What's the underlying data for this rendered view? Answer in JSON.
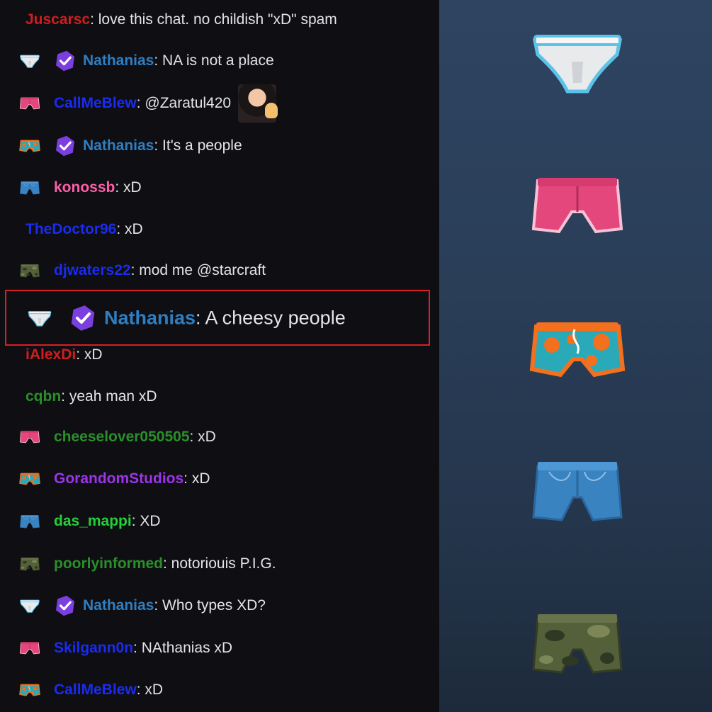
{
  "chat": {
    "messages": [
      {
        "id": "m1",
        "user": "Juscarsc",
        "color": "#d11d1d",
        "badge": null,
        "verified": false,
        "text": ": love this chat. no childish \"xD\" spam"
      },
      {
        "id": "m2",
        "user": "Nathanias",
        "color": "#2f7ec0",
        "badge": "white-briefs",
        "verified": true,
        "text": ": NA is not a place"
      },
      {
        "id": "m3",
        "user": "CallMeBlew",
        "color": "#1a2cf0",
        "badge": "pink-shorts",
        "verified": false,
        "text": ": @Zaratul420",
        "emote": "waving-woman-emote"
      },
      {
        "id": "m4",
        "user": "Nathanias",
        "color": "#2f7ec0",
        "badge": "orange-trunks",
        "verified": true,
        "text": ": It's a people"
      },
      {
        "id": "m5",
        "user": "konossb",
        "color": "#ff5fa8",
        "badge": "denim-shorts",
        "verified": false,
        "text": ": xD"
      },
      {
        "id": "m6",
        "user": "TheDoctor96",
        "color": "#1a2cf0",
        "badge": null,
        "verified": false,
        "text": ": xD"
      },
      {
        "id": "m7",
        "user": "djwaters22",
        "color": "#1a2cf0",
        "badge": "camo-shorts",
        "verified": false,
        "text": ": mod me @starcraft"
      },
      {
        "id": "m8",
        "user": "Nathanias",
        "color": "#2f7ec0",
        "badge": "white-briefs",
        "verified": true,
        "text": ": A cheesy people",
        "highlighted": true
      },
      {
        "id": "m9",
        "user": "iAlexDi",
        "color": "#d11d1d",
        "badge": null,
        "verified": false,
        "text": ": xD"
      },
      {
        "id": "m10",
        "user": "cqbn",
        "color": "#2a8f2a",
        "badge": null,
        "verified": false,
        "text": ": yeah man xD"
      },
      {
        "id": "m11",
        "user": "cheeselover050505",
        "color": "#2a8f2a",
        "badge": "pink-shorts",
        "verified": false,
        "text": ": xD"
      },
      {
        "id": "m12",
        "user": "GorandomStudios",
        "color": "#9b35e8",
        "badge": "orange-trunks",
        "verified": false,
        "text": ": xD"
      },
      {
        "id": "m13",
        "user": "das_mappi",
        "color": "#22d13a",
        "badge": "denim-shorts",
        "verified": false,
        "text": ": XD"
      },
      {
        "id": "m14",
        "user": "poorlyinformed",
        "color": "#2a8f2a",
        "badge": "camo-shorts",
        "verified": false,
        "text": ": notoriouis P.I.G."
      },
      {
        "id": "m15",
        "user": "Nathanias",
        "color": "#2f7ec0",
        "badge": "white-briefs",
        "verified": true,
        "text": ": Who types XD?"
      },
      {
        "id": "m16",
        "user": "Skilgann0n",
        "color": "#1a2cf0",
        "badge": "pink-shorts",
        "verified": false,
        "text": ": NAthanias xD"
      },
      {
        "id": "m17",
        "user": "CallMeBlew",
        "color": "#1a2cf0",
        "badge": "orange-trunks",
        "verified": false,
        "text": ": xD"
      }
    ]
  },
  "sidebar": {
    "items": [
      {
        "id": "g1",
        "icon": "white-briefs-icon"
      },
      {
        "id": "g2",
        "icon": "pink-shorts-icon"
      },
      {
        "id": "g3",
        "icon": "orange-trunks-icon"
      },
      {
        "id": "g4",
        "icon": "denim-shorts-icon"
      },
      {
        "id": "g5",
        "icon": "camo-shorts-icon"
      }
    ]
  },
  "colors": {
    "chat_bg": "#0f0e13",
    "highlight_border": "#d81f24",
    "verified_badge": "#7b3fe0",
    "sidebar_bg": "#2b3f59"
  }
}
